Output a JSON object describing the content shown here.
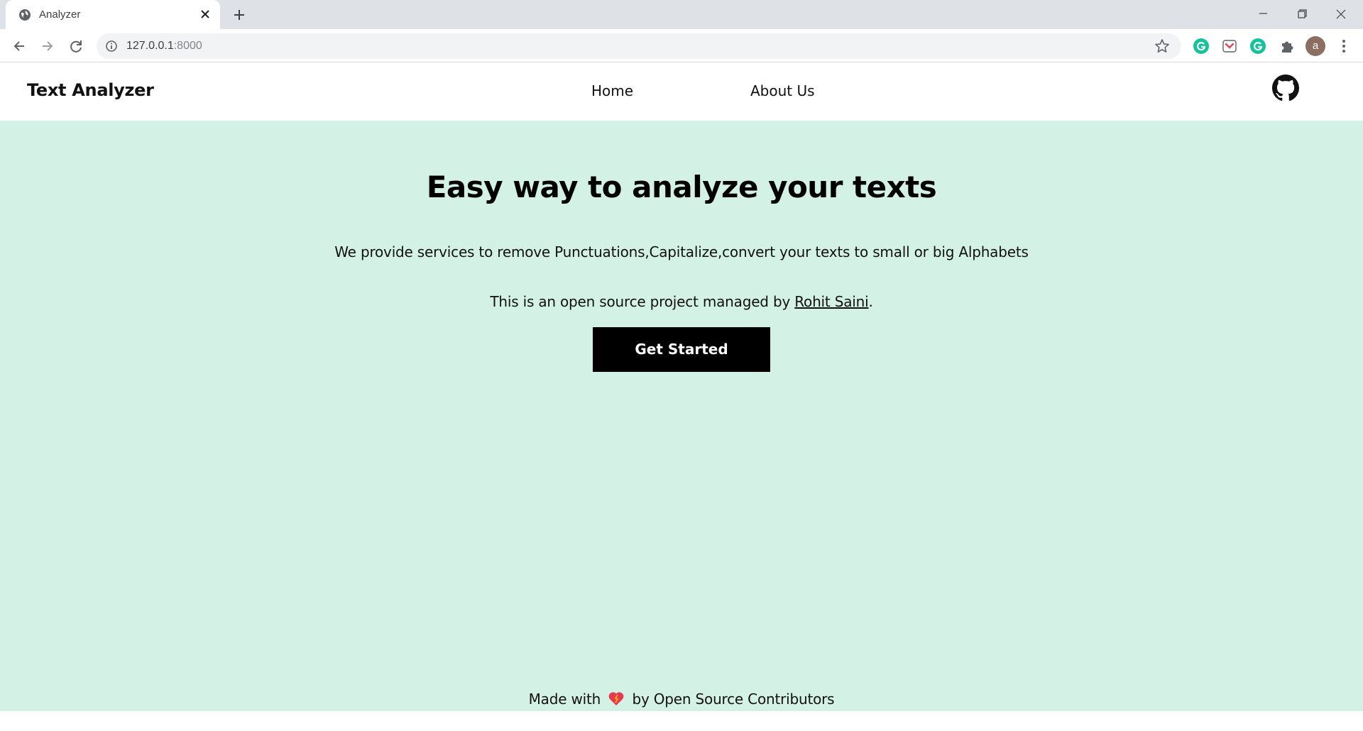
{
  "browser": {
    "tab_title": "Analyzer",
    "url_host": "127.0.0.1",
    "url_port": ":8000",
    "avatar_letter": "a"
  },
  "site": {
    "brand": "Text Analyzer",
    "nav": [
      {
        "label": "Home"
      },
      {
        "label": "About Us"
      }
    ]
  },
  "hero": {
    "title": "Easy way to analyze your texts",
    "subtitle": "We provide services to remove Punctuations,Capitalize,convert your texts to small or big Alphabets",
    "credit_prefix": "This is an open source project managed by ",
    "credit_link": "Rohit Saini",
    "credit_suffix": ".",
    "cta_label": "Get Started"
  },
  "footer": {
    "prefix": "Made with",
    "suffix": "by Open Source Contributors"
  },
  "colors": {
    "page_bg": "#d3f2e5",
    "nav_bg": "#ffffff",
    "cta_bg": "#000000",
    "heart": "#e53950"
  },
  "icons": [
    "globe-icon",
    "close-icon",
    "plus-icon",
    "minimize-icon",
    "restore-icon",
    "back-icon",
    "forward-icon",
    "reload-icon",
    "info-icon",
    "star-icon",
    "grammarly-icon",
    "pocket-icon",
    "puzzle-icon",
    "kebab-menu-icon",
    "github-icon",
    "heart-icon"
  ]
}
